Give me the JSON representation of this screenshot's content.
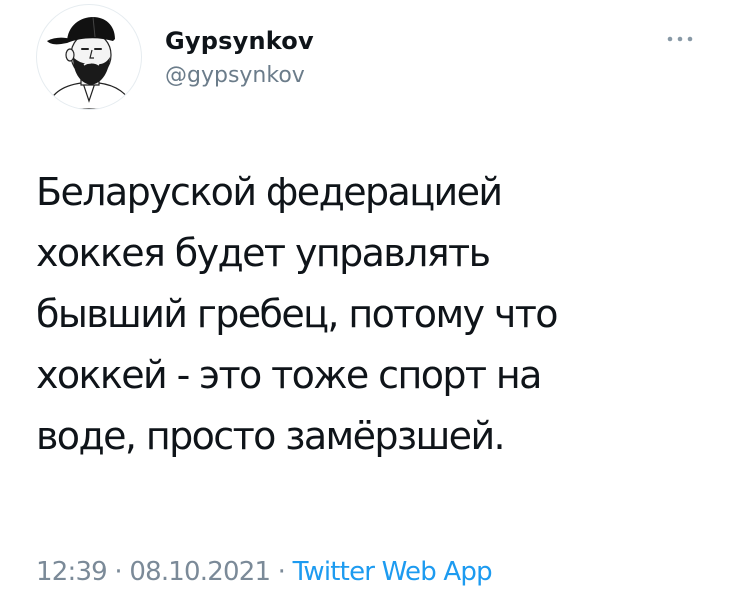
{
  "author": {
    "display_name": "Gypsynkov",
    "handle": "@gypsynkov",
    "avatar_icon": "bearded-man-cap-avatar"
  },
  "more_icon": "ellipsis-icon",
  "tweet": {
    "lines": [
      "Беларуской федерацией",
      "хоккея будет управлять",
      "бывший гребец, потому что",
      "хоккей - это тоже спорт на",
      "воде, просто замёрзшей."
    ]
  },
  "meta": {
    "time": "12:39",
    "separator": " · ",
    "date": "08.10.2021",
    "source": "Twitter Web App"
  },
  "colors": {
    "text": "#0f1419",
    "secondary": "#7b8a98",
    "link": "#1d9bf0"
  }
}
